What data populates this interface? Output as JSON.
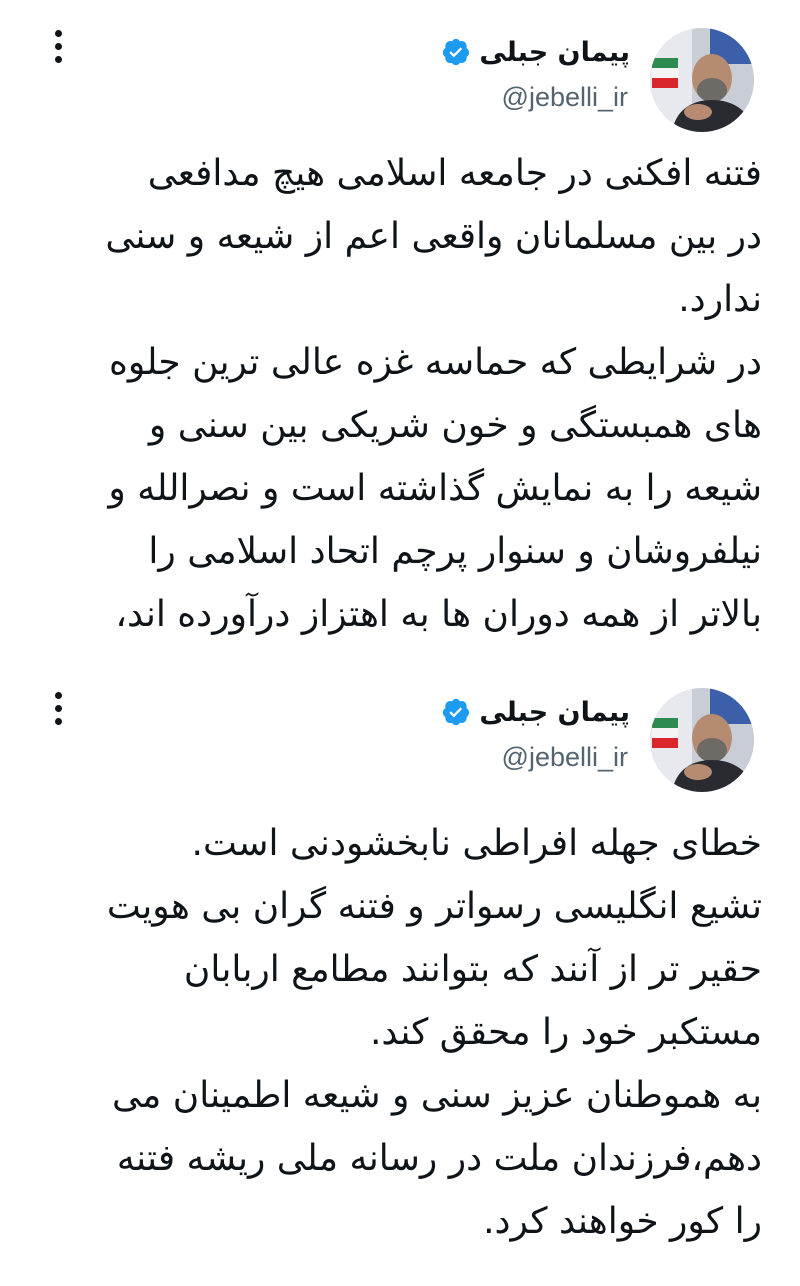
{
  "tweets": [
    {
      "author_name": "پیمان جبلی",
      "handle": "@jebelli_ir",
      "verified_icon": "verified-badge-icon",
      "lines": [
        "فتنه افکنی در جامعه اسلامی هیچ مدافعی",
        "در بین مسلمانان واقعی اعم از شیعه و سنی",
        "ندارد.",
        "در شرایطی که حماسه غزه عالی ترین جلوه",
        "های همبستگی و خون شریکی بین سنی و",
        "شیعه را به نمایش گذاشته است و نصرالله و",
        "نیلفروشان و سنوار پرچم اتحاد اسلامی را",
        "بالاتر از همه دوران ها به اهتزاز درآورده اند،"
      ]
    },
    {
      "author_name": "پیمان جبلی",
      "handle": "@jebelli_ir",
      "verified_icon": "verified-badge-icon",
      "lines": [
        "خطای جهله افراطی نابخشودنی است.",
        "تشیع انگلیسی رسواتر و فتنه گران بی هویت",
        "حقیر تر از آنند که بتوانند مطامع اربابان",
        "مستکبر خود را محقق کند.",
        "به هموطنان عزیز سنی و شیعه اطمینان می",
        "دهم،فرزندان ملت در رسانه ملی  ریشه فتنه",
        "را کور خواهند کرد."
      ]
    }
  ],
  "colors": {
    "text": "#0f1419",
    "handle": "#536471",
    "verified": "#1d9bf0"
  }
}
